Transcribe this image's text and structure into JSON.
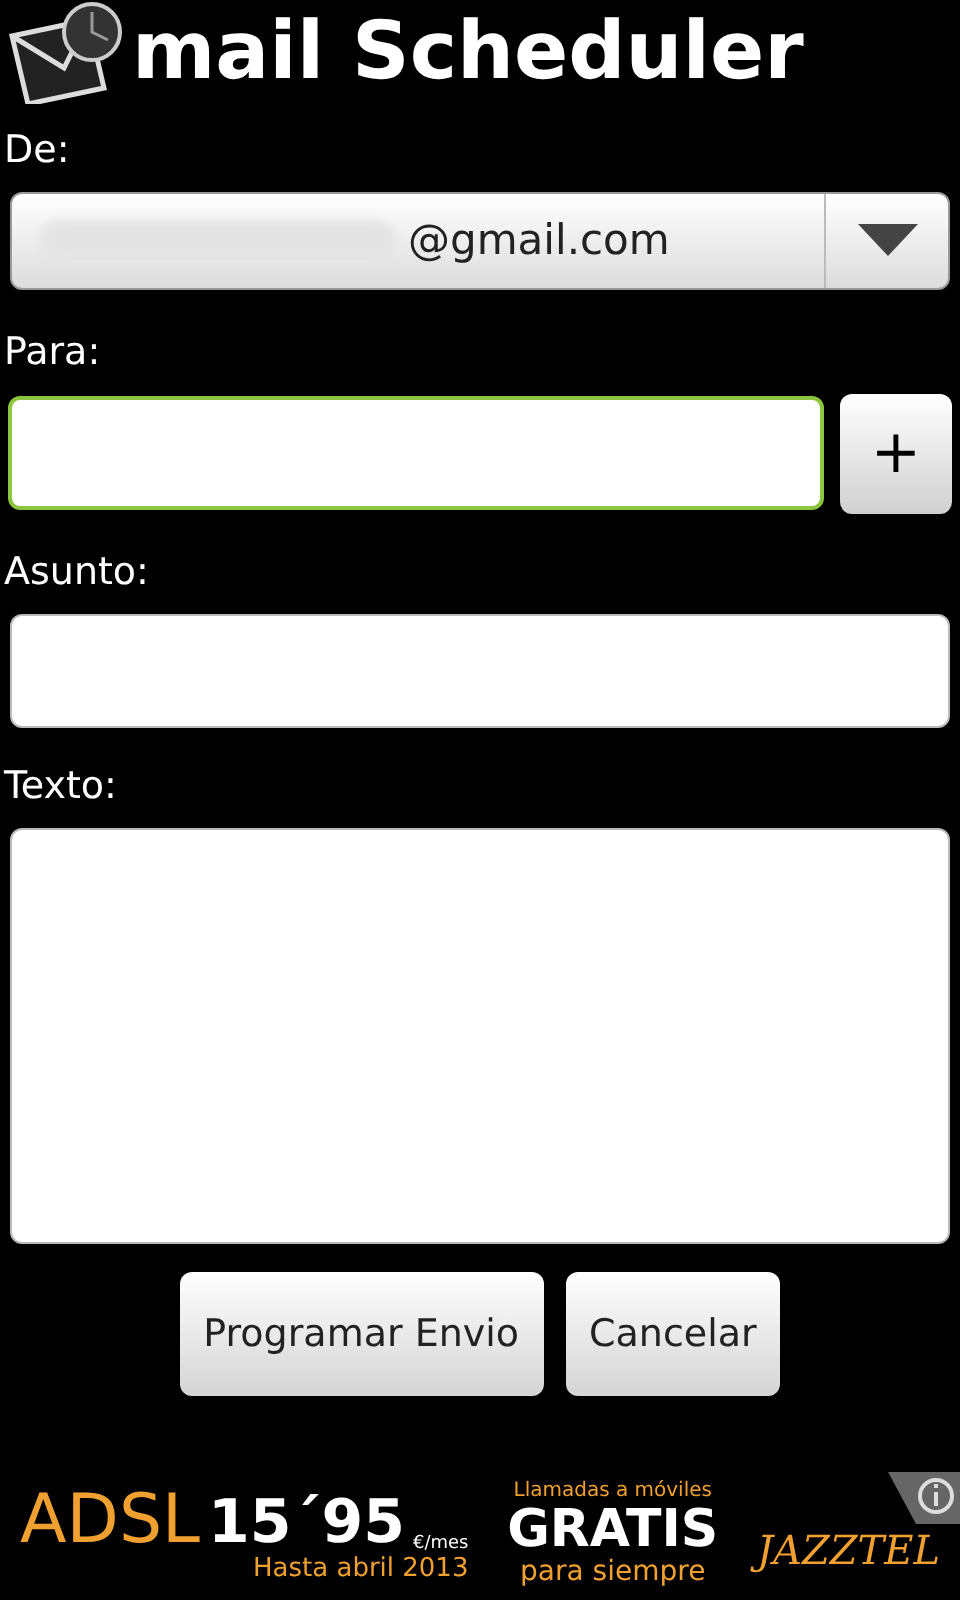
{
  "app": {
    "title": "mail Scheduler"
  },
  "from": {
    "label": "De:",
    "value": "@gmail.com"
  },
  "to": {
    "label": "Para:",
    "focused": true,
    "add_button": "+"
  },
  "subject": {
    "label": "Asunto:",
    "focused": false
  },
  "body": {
    "label": "Texto:",
    "focused": false
  },
  "buttons": [
    "Programar Envio",
    "Cancelar"
  ],
  "ad": {
    "product": "ADSL",
    "price": "15´95",
    "unit": "€/mes",
    "until": "Hasta abril 2013",
    "line_1": "Llamadas a móviles",
    "line_2": "GRATIS",
    "line_3": "para siempre",
    "brand": "JAZZTEL"
  }
}
